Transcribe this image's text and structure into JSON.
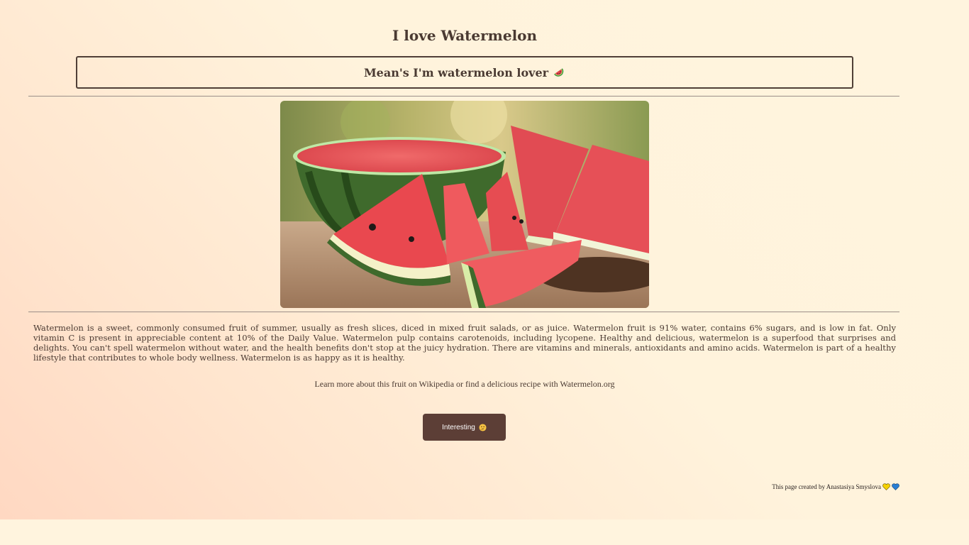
{
  "header": {
    "title": "I love Watermelon",
    "subtitle": "Mean's I'm watermelon lover",
    "subtitle_icon": "watermelon-slice-icon"
  },
  "hero_image": {
    "alt": "watermelon slices",
    "icon": "watermelon-photo"
  },
  "description": "Watermelon is a sweet, commonly consumed fruit of summer, usually as fresh slices, diced in mixed fruit salads, or as juice. Watermelon fruit is 91% water, contains 6% sugars, and is low in fat. Only vitamin C is present in appreciable content at 10% of the Daily Value. Watermelon pulp contains carotenoids, including lycopene. Healthy and delicious, watermelon is a superfood that surprises and delights. You can't spell watermelon without water, and the health benefits don't stop at the juicy hydration. There are vitamins and minerals, antioxidants and amino acids. Watermelon is part of a healthy lifestyle that contributes to whole body wellness. Watermelon is as happy as it is healthy.",
  "learn_more": "Learn more about this fruit on Wikipedia or find a delicious recipe with Watermelon.org",
  "button": {
    "label": "Interesting",
    "icon": "thinking-face-icon"
  },
  "footer": {
    "text": "This page created by Anastasiya Smyslova",
    "icons": [
      "yellow-heart-icon",
      "blue-heart-icon"
    ]
  },
  "colors": {
    "background": "#fff4de",
    "gradient_corner": "#ffd8c2",
    "text": "#4a3a32",
    "button": "#5c3e36",
    "border": "#4f3f37"
  }
}
